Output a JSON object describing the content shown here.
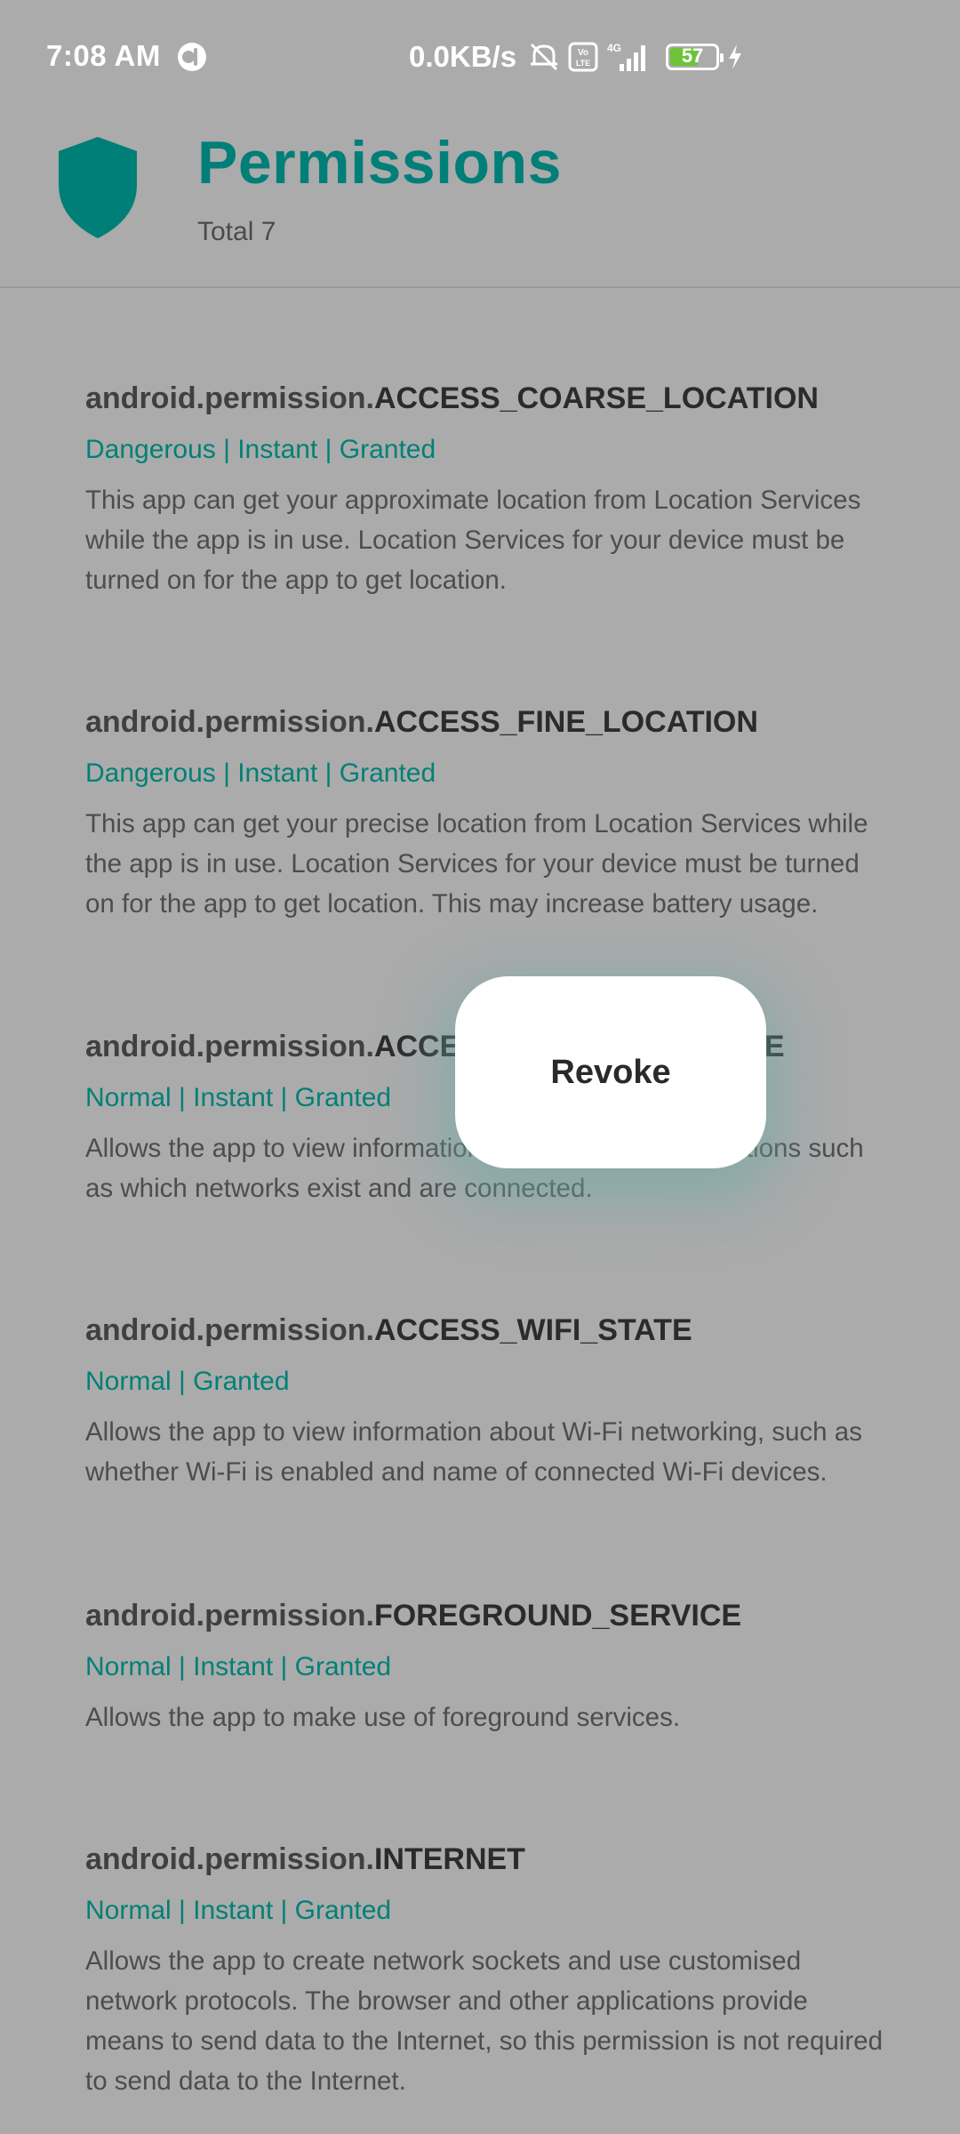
{
  "status_bar": {
    "time": "7:08 AM",
    "network_speed": "0.0KB/s",
    "network_type": "4G",
    "volte_label": "Vo LTE",
    "battery_level": "57",
    "icons": [
      "app-status-icon",
      "mute-icon",
      "volte-icon",
      "signal-icon",
      "battery-icon",
      "charging-icon"
    ]
  },
  "header": {
    "title": "Permissions",
    "subtitle": "Total 7",
    "icon": "shield-icon"
  },
  "permissions": [
    {
      "prefix": "android.permission.",
      "name": "ACCESS_COARSE_LOCATION",
      "tags": "Dangerous | Instant | Granted",
      "description": "This app can get your approximate location from Location Services while the app is in use. Location Services for your device must be turned on for the app to get location."
    },
    {
      "prefix": "android.permission.",
      "name": "ACCESS_FINE_LOCATION",
      "tags": "Dangerous | Instant | Granted",
      "description": "This app can get your precise location from Location Services while the app is in use. Location Services for your device must be turned on for the app to get location. This may increase battery usage."
    },
    {
      "prefix": "android.permission.",
      "name": "ACCESS_NETWORK_STATE",
      "tags": "Normal | Instant | Granted",
      "description": "Allows the app to view information about network connections such as which networks exist and are connected."
    },
    {
      "prefix": "android.permission.",
      "name": "ACCESS_WIFI_STATE",
      "tags": "Normal | Granted",
      "description": "Allows the app to view information about Wi-Fi networking, such as whether Wi-Fi is enabled and name of connected Wi-Fi devices."
    },
    {
      "prefix": "android.permission.",
      "name": "FOREGROUND_SERVICE",
      "tags": "Normal | Instant | Granted",
      "description": "Allows the app to make use of foreground services."
    },
    {
      "prefix": "android.permission.",
      "name": "INTERNET",
      "tags": "Normal | Instant | Granted",
      "description": "Allows the app to create network sockets and use customised network protocols. The browser and other applications provide means to send data to the Internet, so this permission is not required to send data to the Internet."
    }
  ],
  "popup": {
    "revoke_label": "Revoke"
  },
  "colors": {
    "accent": "#007f78",
    "overlay_background": "#ababab",
    "battery_fill": "#6fc33a"
  }
}
